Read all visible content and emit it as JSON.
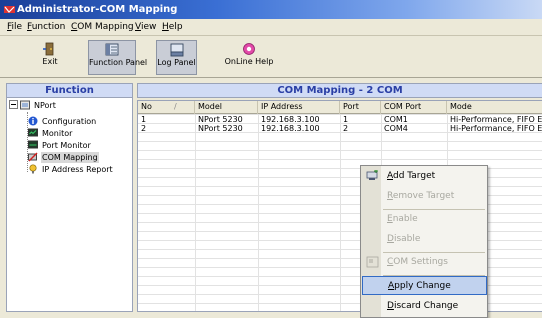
{
  "window": {
    "title": "Administrator-COM Mapping"
  },
  "menubar": [
    "File",
    "Function",
    "COM Mapping",
    "View",
    "Help"
  ],
  "toolbar": {
    "exit": "Exit",
    "function_panel": "Function Panel",
    "log_panel": "Log Panel",
    "online_help": "OnLine Help"
  },
  "function_panel": {
    "title": "Function",
    "root": "NPort",
    "items": [
      "Configuration",
      "Monitor",
      "Port Monitor",
      "COM Mapping",
      "IP Address Report"
    ]
  },
  "mapping": {
    "title": "COM Mapping - 2 COM",
    "columns": [
      "No",
      "Model",
      "IP Address",
      "Port",
      "COM Port",
      "Mode"
    ],
    "rows": [
      [
        "1",
        "NPort 5230",
        "192.168.3.100",
        "1",
        "COM1",
        "Hi-Performance, FIFO En"
      ],
      [
        "2",
        "NPort 5230",
        "192.168.3.100",
        "2",
        "COM4",
        "Hi-Performance, FIFO En"
      ]
    ]
  },
  "context_menu": {
    "items": [
      {
        "label": "Add Target",
        "enabled": true,
        "icon": "add-target-icon"
      },
      {
        "label": "Remove Target",
        "enabled": false
      },
      {
        "label": "Enable",
        "enabled": false
      },
      {
        "label": "Disable",
        "enabled": false
      },
      {
        "label": "COM Settings",
        "enabled": false,
        "icon": "com-settings-icon"
      },
      {
        "label": "Apply Change",
        "enabled": true,
        "highlighted": true
      },
      {
        "label": "Discard Change",
        "enabled": true
      }
    ]
  },
  "colors": {
    "title_bar": "#1a3f98",
    "panel_header_text": "#2a3fa5",
    "panel_header_bg": "#d0dbf5",
    "menu_highlight": "#c1d2ee"
  }
}
